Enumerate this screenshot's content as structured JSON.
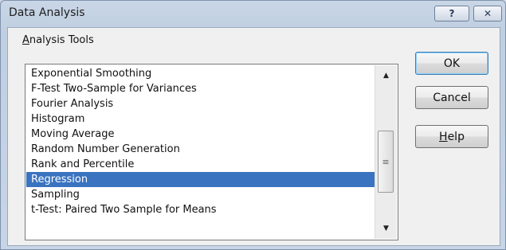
{
  "window": {
    "title": "Data Analysis",
    "help_glyph": "?",
    "close_glyph": "✕"
  },
  "group": {
    "label_accel": "A",
    "label_rest": "nalysis Tools"
  },
  "list": {
    "items": [
      "Exponential Smoothing",
      "F-Test Two-Sample for Variances",
      "Fourier Analysis",
      "Histogram",
      "Moving Average",
      "Random Number Generation",
      "Rank and Percentile",
      "Regression",
      "Sampling",
      "t-Test: Paired Two Sample for Means"
    ],
    "selected": "Regression"
  },
  "scrollbar": {
    "up_glyph": "▲",
    "down_glyph": "▼",
    "grip_glyph": "≡"
  },
  "buttons": {
    "ok": "OK",
    "cancel": "Cancel",
    "help_accel": "H",
    "help_rest": "elp"
  },
  "colors": {
    "selection": "#3a73c0",
    "title_bar": "#c9d6e6"
  }
}
